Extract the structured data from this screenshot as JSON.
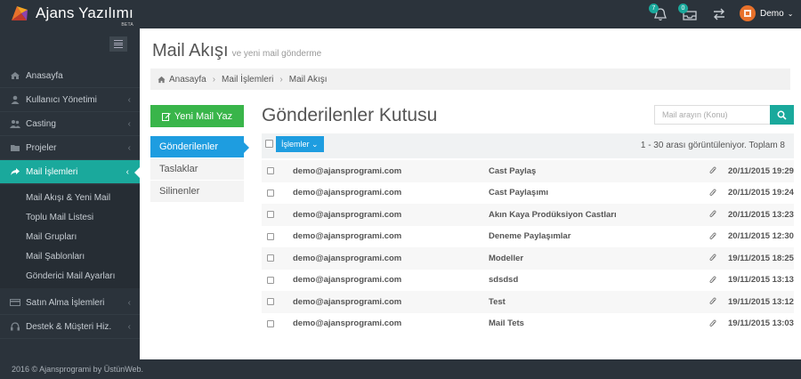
{
  "app": {
    "title": "Ajans Yazılımı",
    "beta": "BETA"
  },
  "topbar": {
    "notifications_count": "7",
    "tasks_count": "0",
    "user_name": "Demo"
  },
  "sidebar": {
    "items": [
      {
        "label": "Anasayfa",
        "icon": "home-icon"
      },
      {
        "label": "Kullanıcı Yönetimi",
        "icon": "user-icon"
      },
      {
        "label": "Casting",
        "icon": "users-icon"
      },
      {
        "label": "Projeler",
        "icon": "folder-icon"
      },
      {
        "label": "Mail İşlemleri",
        "icon": "share-icon"
      },
      {
        "label": "Satın Alma İşlemleri",
        "icon": "credit-card-icon"
      },
      {
        "label": "Destek & Müşteri Hiz.",
        "icon": "headset-icon"
      }
    ],
    "sub_items": [
      "Mail Akışı & Yeni Mail",
      "Toplu Mail Listesi",
      "Mail Grupları",
      "Mail Şablonları",
      "Gönderici Mail Ayarları"
    ],
    "caret": "‹"
  },
  "footer": {
    "text": "2016 © Ajansprogrami by ÜstünWeb."
  },
  "page": {
    "title": "Mail Akışı",
    "subtitle": "ve yeni mail gönderme",
    "breadcrumb": [
      "Anasayfa",
      "Mail İşlemleri",
      "Mail Akışı"
    ],
    "breadcrumb_sep": "›"
  },
  "mail": {
    "new_button": "Yeni Mail Yaz",
    "folders": [
      "Gönderilenler",
      "Taslaklar",
      "Silinenler"
    ],
    "inbox_title": "Gönderilenler Kutusu",
    "search_placeholder": "Mail arayın (Konu)",
    "actions_label": "İşlemler",
    "pager_text": "1 - 30 arası görüntüleniyor. Toplam 8",
    "rows": [
      {
        "from": "demo@ajansprogrami.com",
        "subject": "Cast Paylaş",
        "date": "20/11/2015 19:29"
      },
      {
        "from": "demo@ajansprogrami.com",
        "subject": "Cast Paylaşımı",
        "date": "20/11/2015 19:24"
      },
      {
        "from": "demo@ajansprogrami.com",
        "subject": "Akın Kaya Prodüksiyon Castları",
        "date": "20/11/2015 13:23"
      },
      {
        "from": "demo@ajansprogrami.com",
        "subject": "Deneme Paylaşımlar",
        "date": "20/11/2015 12:30"
      },
      {
        "from": "demo@ajansprogrami.com",
        "subject": "Modeller",
        "date": "19/11/2015 18:25"
      },
      {
        "from": "demo@ajansprogrami.com",
        "subject": "sdsdsd",
        "date": "19/11/2015 13:13"
      },
      {
        "from": "demo@ajansprogrami.com",
        "subject": "Test",
        "date": "19/11/2015 13:12"
      },
      {
        "from": "demo@ajansprogrami.com",
        "subject": "Mail Tets",
        "date": "19/11/2015 13:03"
      }
    ]
  },
  "colors": {
    "accent": "#1aa99c",
    "primary": "#1e9de0",
    "success": "#39b54a",
    "dark": "#2b333b"
  }
}
